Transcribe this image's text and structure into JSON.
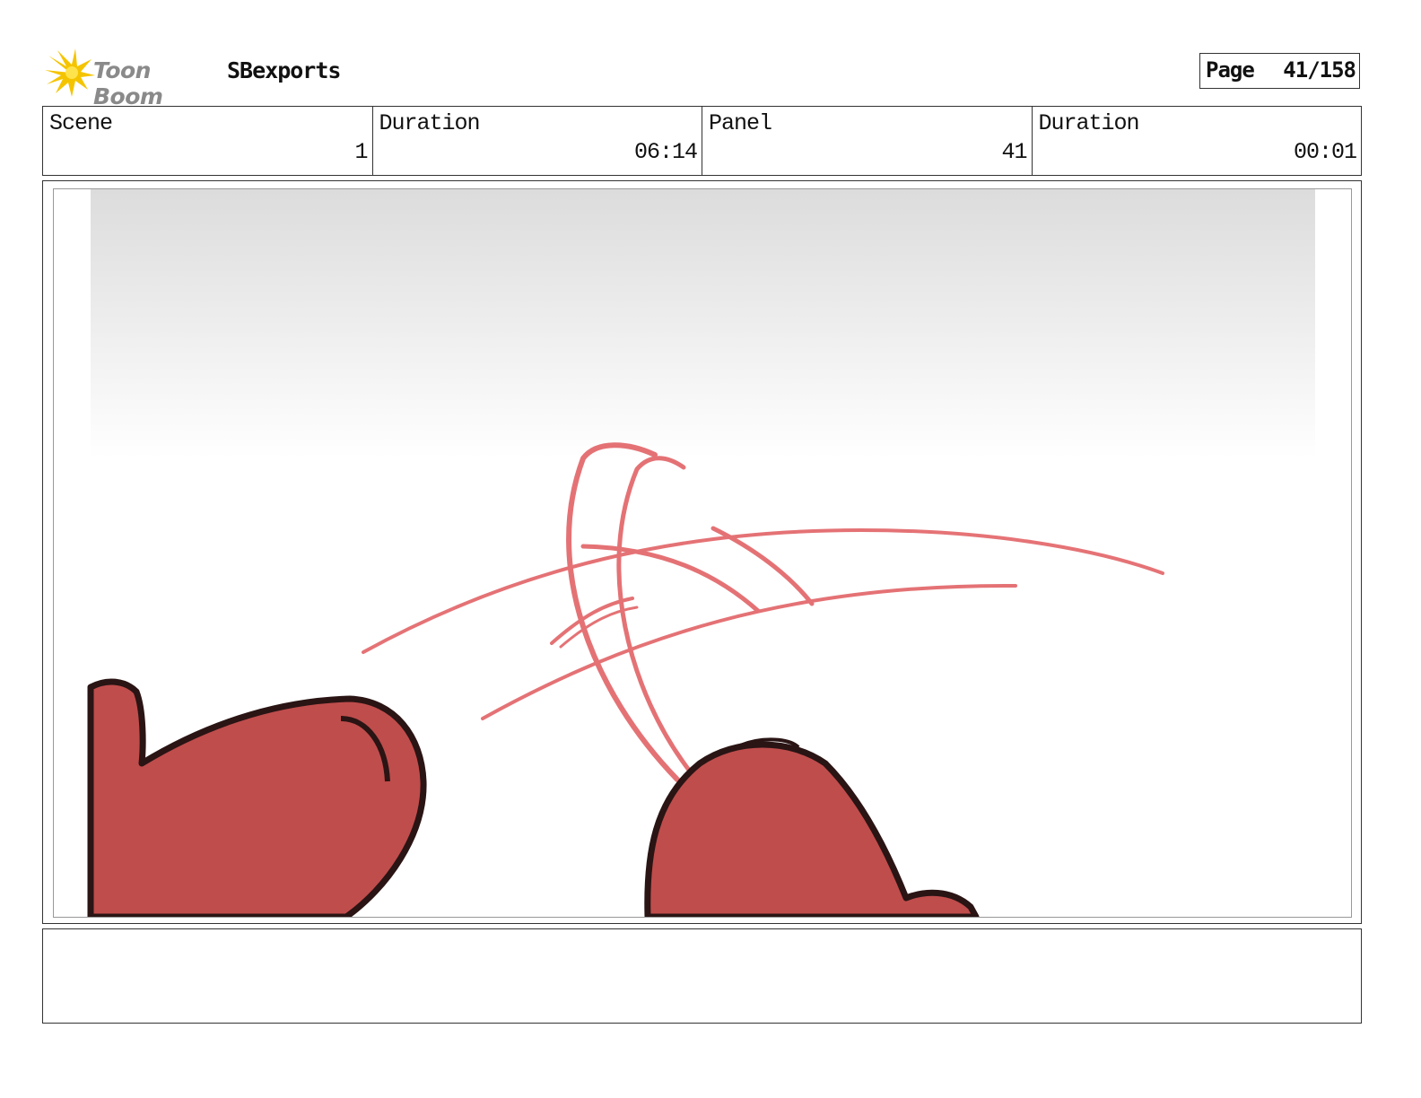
{
  "header": {
    "logo_text": "Toon Boom",
    "project_title": "SBexports",
    "page_label": "Page",
    "page_value": "41/158"
  },
  "info": {
    "scene_label": "Scene",
    "scene_value": "1",
    "scene_duration_label": "Duration",
    "scene_duration_value": "06:14",
    "panel_label": "Panel",
    "panel_value": "41",
    "panel_duration_label": "Duration",
    "panel_duration_value": "00:01"
  },
  "colors": {
    "character_fill": "#bf4d4c",
    "character_outline": "#2a1414",
    "motion_lines": "#e05a5e",
    "logo_star": "#f5c400",
    "border": "#333333"
  },
  "icons": {
    "logo": "toon-boom-star-icon"
  }
}
